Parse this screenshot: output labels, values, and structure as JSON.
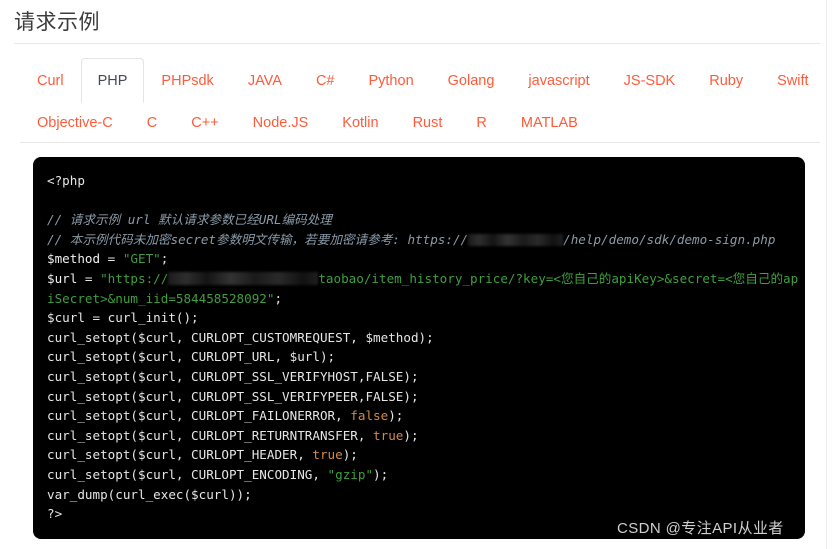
{
  "header": {
    "title": "请求示例"
  },
  "tabs": {
    "active": "PHP",
    "row1": [
      {
        "label": "Curl",
        "active": false
      },
      {
        "label": "PHP",
        "active": true
      },
      {
        "label": "PHPsdk",
        "active": false
      },
      {
        "label": "JAVA",
        "active": false
      },
      {
        "label": "C#",
        "active": false
      },
      {
        "label": "Python",
        "active": false
      },
      {
        "label": "Golang",
        "active": false
      },
      {
        "label": "javascript",
        "active": false
      },
      {
        "label": "JS-SDK",
        "active": false
      },
      {
        "label": "Ruby",
        "active": false
      },
      {
        "label": "Swift",
        "active": false
      }
    ],
    "row2": [
      {
        "label": "Objective-C",
        "active": false
      },
      {
        "label": "C",
        "active": false
      },
      {
        "label": "C++",
        "active": false
      },
      {
        "label": "Node.JS",
        "active": false
      },
      {
        "label": "Kotlin",
        "active": false
      },
      {
        "label": "Rust",
        "active": false
      },
      {
        "label": "R",
        "active": false
      },
      {
        "label": "MATLAB",
        "active": false
      }
    ]
  },
  "code": {
    "language": "PHP",
    "open_tag": "<?php",
    "comment_1": "// 请求示例 url 默认请求参数已经URL编码处理",
    "comment_2_prefix": "// 本示例代码未加密secret参数明文传输，若要加密请参考: https://",
    "comment_2_suffix": "/help/demo/sdk/demo-sign.php",
    "line_method_name": "$method",
    "line_method_eq": " = ",
    "line_method_value": "\"GET\"",
    "line_method_end": ";",
    "line_url_name": "$url",
    "line_url_eq": " = ",
    "line_url_prefix": "\"https://",
    "line_url_suffix": "taobao/item_history_price/?key=<您自己的apiKey>&secret=<您自己的apiSecret>&num_iid=584458528092\"",
    "line_url_end": ";",
    "line_curl_init": "$curl = curl_init();",
    "setopt_customrequest": "curl_setopt($curl, CURLOPT_CUSTOMREQUEST, $method);",
    "setopt_url": "curl_setopt($curl, CURLOPT_URL, $url);",
    "setopt_verifyhost": "curl_setopt($curl, CURLOPT_SSL_VERIFYHOST,FALSE);",
    "setopt_verifypeer": "curl_setopt($curl, CURLOPT_SSL_VERIFYPEER,FALSE);",
    "setopt_failonerror_pre": "curl_setopt($curl, CURLOPT_FAILONERROR, ",
    "setopt_failonerror_val": "false",
    "setopt_failonerror_post": ");",
    "setopt_returntransfer_pre": "curl_setopt($curl, CURLOPT_RETURNTRANSFER, ",
    "setopt_returntransfer_val": "true",
    "setopt_returntransfer_post": ");",
    "setopt_header_pre": "curl_setopt($curl, CURLOPT_HEADER, ",
    "setopt_header_val": "true",
    "setopt_header_post": ");",
    "setopt_encoding_pre": "curl_setopt($curl, CURLOPT_ENCODING, ",
    "setopt_encoding_val": "\"gzip\"",
    "setopt_encoding_post": ");",
    "line_var_dump": "var_dump(curl_exec($curl));",
    "close_tag": "?>"
  },
  "watermark": {
    "text": "CSDN @专注API从业者"
  },
  "colors": {
    "tab_accent": "#ff5b3a",
    "tab_active_text": "#444a52",
    "code_background": "#000000",
    "code_text": "#e6e6e6",
    "code_comment": "#8a9aa8",
    "code_string": "#3f9e3f",
    "code_keyword": "#d08a4c",
    "title_text": "#3c3c3c",
    "divider": "#e8e8e8"
  }
}
